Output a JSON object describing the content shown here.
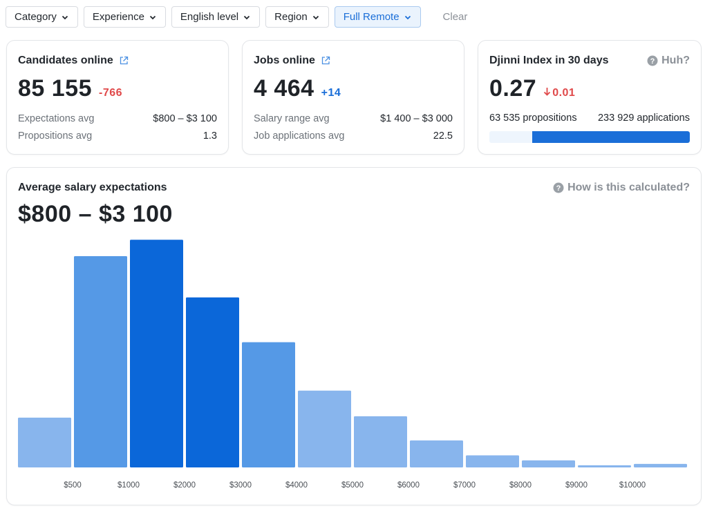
{
  "filters": {
    "items": [
      {
        "label": "Category",
        "active": false
      },
      {
        "label": "Experience",
        "active": false
      },
      {
        "label": "English level",
        "active": false
      },
      {
        "label": "Region",
        "active": false
      },
      {
        "label": "Full Remote",
        "active": true
      }
    ],
    "clear_label": "Clear"
  },
  "candidates": {
    "title": "Candidates online",
    "value": "85 155",
    "delta": "-766",
    "rows": [
      {
        "label": "Expectations avg",
        "value": "$800 – $3 100"
      },
      {
        "label": "Propositions avg",
        "value": "1.3"
      }
    ]
  },
  "jobs": {
    "title": "Jobs online",
    "value": "4 464",
    "delta": "+14",
    "rows": [
      {
        "label": "Salary range avg",
        "value": "$1 400 – $3 000"
      },
      {
        "label": "Job applications avg",
        "value": "22.5"
      }
    ]
  },
  "djinni": {
    "title": "Djinni Index in 30 days",
    "help_label": "Huh?",
    "value": "0.27",
    "delta": "0.01",
    "propositions": "63 535 propositions",
    "applications": "233 929 applications",
    "applications_share": 0.786
  },
  "salary": {
    "title": "Average salary expectations",
    "range": "$800 – $3 100",
    "help_label": "How is this calculated?"
  },
  "colors": {
    "accent": "#1a6ed8",
    "bar_dark": "#0b67d9",
    "bar_mid": "#5599e6",
    "bar_light": "#88b5ed",
    "negative": "#e0494a"
  },
  "chart_data": {
    "type": "bar",
    "tick_labels": [
      "$500",
      "$1000",
      "$2000",
      "$3000",
      "$4000",
      "$5000",
      "$6000",
      "$7000",
      "$8000",
      "$9000",
      "$10000"
    ],
    "values": [
      70,
      297,
      320,
      239,
      176,
      108,
      72,
      38,
      17,
      10,
      3,
      5
    ],
    "shades": [
      "light",
      "mid",
      "dark",
      "dark",
      "mid",
      "light",
      "light",
      "light",
      "light",
      "light",
      "light",
      "light"
    ],
    "ylim": [
      0,
      330
    ],
    "grid": false
  }
}
